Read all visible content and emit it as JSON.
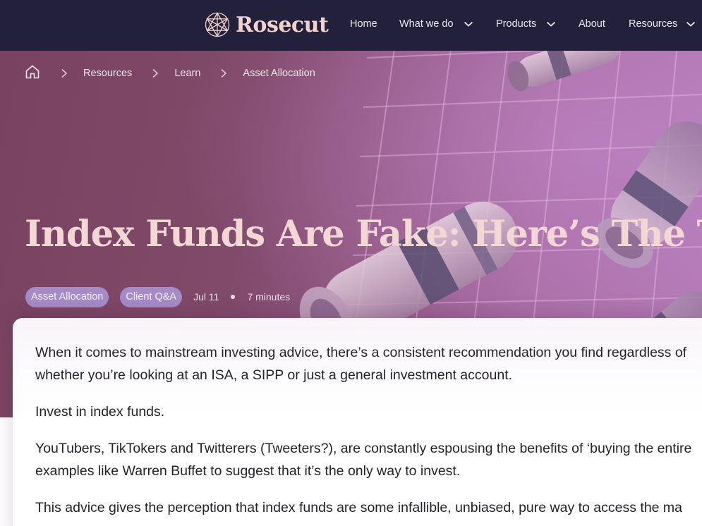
{
  "header": {
    "brand": "Rosecut",
    "nav": [
      {
        "label": "Home",
        "has_dropdown": false
      },
      {
        "label": "What we do",
        "has_dropdown": true
      },
      {
        "label": "Products",
        "has_dropdown": true
      },
      {
        "label": "About",
        "has_dropdown": false
      },
      {
        "label": "Resources",
        "has_dropdown": true
      }
    ]
  },
  "breadcrumb": {
    "home_icon": "home-icon",
    "separator_icon": "chevron-right-icon",
    "items": [
      "Resources",
      "Learn",
      "Asset Allocation"
    ]
  },
  "hero": {
    "title": "Index Funds Are Fake: Here’s The Truth",
    "tags": [
      "Asset Allocation",
      "Client Q&A"
    ],
    "date": "Jul 11",
    "read_time": "7 minutes"
  },
  "article": {
    "paragraphs": [
      [
        "When it comes to mainstream investing advice, there’s a consistent recommendation you find regardless of",
        "whether you’re looking at an ISA, a SIPP or just a general investment account."
      ],
      [
        "Invest in index funds."
      ],
      [
        "YouTubers, TikTokers and Twitterers (Tweeters?), are constantly espousing the benefits of ‘buying the entire",
        "examples like Warren Buffet to suggest that it’s the only way to invest."
      ],
      [
        "This advice gives the perception that index funds are some infallible, unbiased, pure way to access the ma"
      ]
    ]
  },
  "colors": {
    "nav_bg": "#22203a",
    "brand": "#f2d2cc",
    "title": "#f3d7d4",
    "tag_bg": "#a58bc8",
    "hero_from": "#7a4260",
    "hero_to": "#b27ab6",
    "body_text": "#25222d"
  }
}
